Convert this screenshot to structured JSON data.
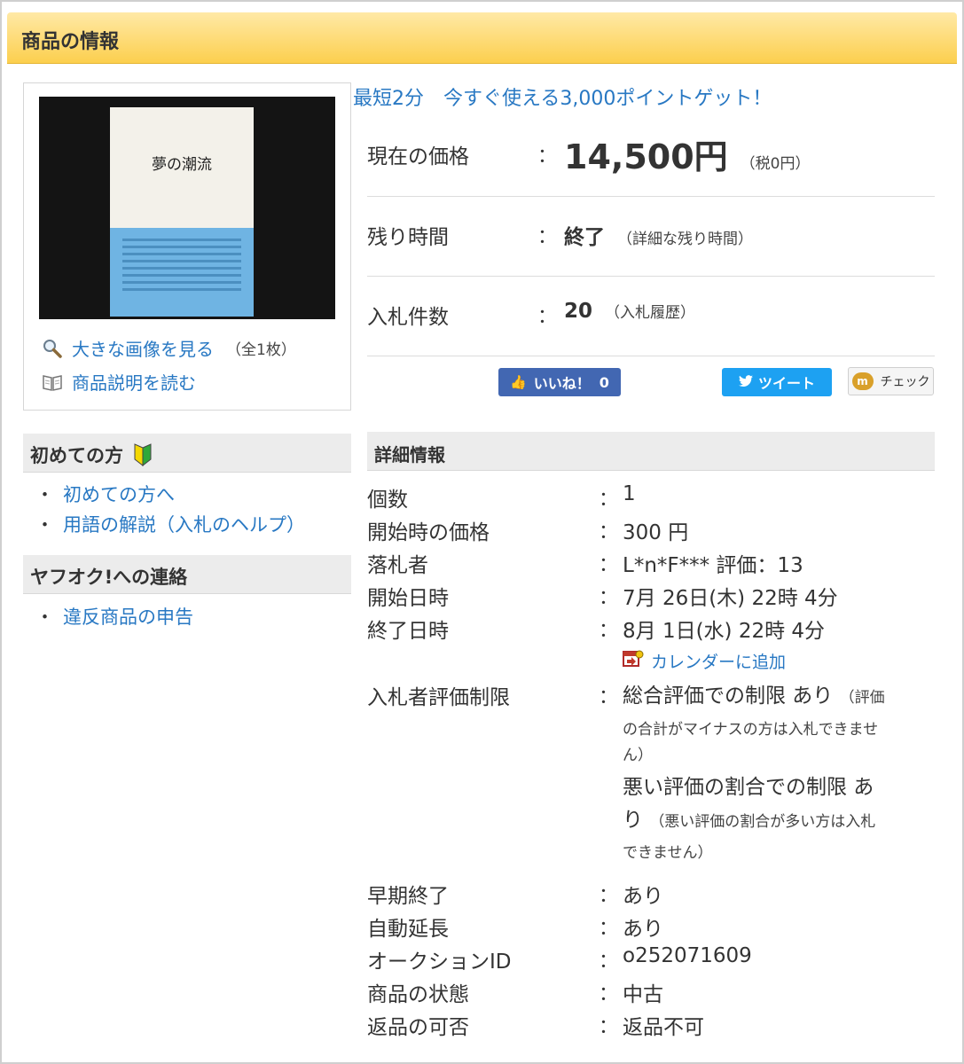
{
  "header": {
    "title": "商品の情報"
  },
  "image_panel": {
    "book": {
      "title": "夢の潮流"
    },
    "view_large_label": "大きな画像を見る",
    "image_count": "（全1枚）",
    "read_description_label": "商品説明を読む"
  },
  "promo": {
    "text": "最短2分　今すぐ使える3,000ポイントゲット！"
  },
  "summary": {
    "price": {
      "label": "現在の価格",
      "colon": "：",
      "value": "14,500円",
      "tax": "（税0円）"
    },
    "time_left": {
      "label": "残り時間",
      "colon": "：",
      "value": "終了",
      "detail_link": "（詳細な残り時間）"
    },
    "bids": {
      "label": "入札件数",
      "colon": "：",
      "value": "20",
      "history_link": "（入札履歴）"
    }
  },
  "social": {
    "like_label": "いいね！",
    "like_count": "0",
    "tweet_label": "ツイート",
    "check_label": "チェック"
  },
  "sidebar": {
    "beginners": {
      "heading": "初めての方",
      "items": [
        "初めての方へ",
        "用語の解説（入札のヘルプ）"
      ]
    },
    "contact": {
      "heading": "ヤフオク!への連絡",
      "items": [
        "違反商品の申告"
      ]
    }
  },
  "details": {
    "heading": "詳細情報",
    "colon": "：",
    "quantity": {
      "label": "個数",
      "value": "1"
    },
    "start_price": {
      "label": "開始時の価格",
      "value": "300 円"
    },
    "winner": {
      "label": "落札者",
      "value": "L*n*F*** 評価：13"
    },
    "start_date": {
      "label": "開始日時",
      "value": "7月 26日(木) 22時 4分"
    },
    "end_date": {
      "label": "終了日時",
      "value": "8月 1日(水) 22時 4分"
    },
    "calendar_link": "カレンダーに追加",
    "bidder_restriction": {
      "label": "入札者評価制限",
      "line1_main": "総合評価での制限 あり",
      "line1_note_a": "（評価",
      "line1_note_b": "の合計がマイナスの方は入札できませ",
      "line1_note_c": "ん）",
      "line2_main_a": "悪い評価の割合での制限 あ",
      "line2_main_b": "り",
      "line2_note_a": "（悪い評価の割合が多い方は入札",
      "line2_note_b": "できません）"
    },
    "early_end": {
      "label": "早期終了",
      "value": "あり"
    },
    "auto_extend": {
      "label": "自動延長",
      "value": "あり"
    },
    "auction_id": {
      "label": "オークションID",
      "value": "o252071609"
    },
    "condition": {
      "label": "商品の状態",
      "value": "中古"
    },
    "returns": {
      "label": "返品の可否",
      "value": "返品不可"
    }
  }
}
